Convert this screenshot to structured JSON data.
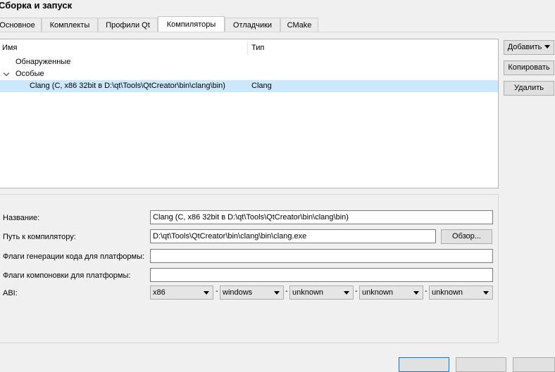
{
  "window": {
    "title": "Сборка и запуск"
  },
  "tabs": [
    {
      "label": "Основное"
    },
    {
      "label": "Комплекты"
    },
    {
      "label": "Профили Qt"
    },
    {
      "label": "Компиляторы"
    },
    {
      "label": "Отладчики"
    },
    {
      "label": "CMake"
    }
  ],
  "active_tab": "Компиляторы",
  "tree": {
    "columns": [
      "Имя",
      "Тип"
    ],
    "groups": [
      {
        "label": "Обнаруженные"
      },
      {
        "label": "Особые",
        "expanded": true
      }
    ],
    "items": [
      {
        "name": "Clang (C, x86 32bit в D:\\qt\\Tools\\QtCreator\\bin\\clang\\bin)",
        "type": "Clang",
        "selected": true
      }
    ]
  },
  "buttons": {
    "add": "Добавить",
    "copy": "Копировать",
    "remove": "Удалить"
  },
  "details": {
    "name_label": "Название:",
    "name_value": "Clang (C, x86 32bit в D:\\qt\\Tools\\QtCreator\\bin\\clang\\bin)",
    "path_label": "Путь к компилятору:",
    "path_value": "D:\\qt\\Tools\\QtCreator\\bin\\clang\\bin\\clang.exe",
    "browse_label": "Обзор...",
    "codegen_flags_label": "Флаги генерации кода для платформы:",
    "codegen_flags_value": "",
    "link_flags_label": "Флаги компоновки для платформы:",
    "link_flags_value": "",
    "abi_label": "ABI:",
    "abi": [
      "x86",
      "windows",
      "unknown",
      "unknown",
      "unknown"
    ],
    "abi_separator": "-"
  },
  "colors": {
    "selection": "#cce8ff",
    "default_button_border": "#0078d7"
  }
}
